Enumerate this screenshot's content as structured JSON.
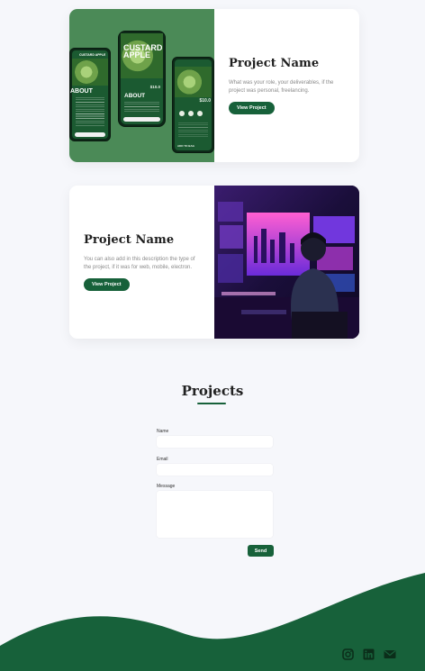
{
  "projects": [
    {
      "title": "Project Name",
      "description": "What was your role, your deliverables, if the project was personal, freelancing.",
      "button": "View Project",
      "mockup": {
        "brand_small": "CUSTARD APPLE",
        "brand_big": "CUSTARD APPLE",
        "about": "ABOUT",
        "price": "$10.0",
        "cta": "ADD TO BAG"
      }
    },
    {
      "title": "Project Name",
      "description": "You can also add in this description the type of the project, if it was for web, mobile, electron.",
      "button": "View Project"
    }
  ],
  "contact": {
    "heading": "Projects",
    "fields": {
      "name_label": "Name",
      "email_label": "Email",
      "message_label": "Message"
    },
    "send": "Send"
  },
  "footer": {
    "icons": [
      "instagram-icon",
      "linkedin-icon",
      "mail-icon"
    ],
    "wave_color": "#17613a"
  },
  "colors": {
    "accent": "#17613a",
    "background": "#f6f7fb"
  }
}
